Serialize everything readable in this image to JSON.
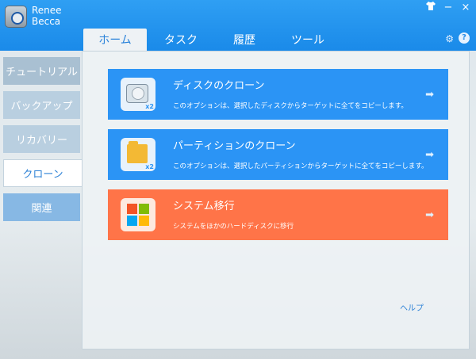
{
  "app": {
    "name_line1": "Renee",
    "name_line2": "Becca"
  },
  "window": {
    "shirt_icon": "shirt-icon",
    "minimize": "−",
    "close": "×"
  },
  "tabs": [
    {
      "label": "ホーム"
    },
    {
      "label": "タスク"
    },
    {
      "label": "履歴"
    },
    {
      "label": "ツール"
    }
  ],
  "sidebar": {
    "items": [
      {
        "label": "チュートリアル"
      },
      {
        "label": "バックアップ"
      },
      {
        "label": "リカバリー"
      },
      {
        "label": "クローン"
      },
      {
        "label": "関連"
      }
    ]
  },
  "cards": [
    {
      "title": "ディスクのクローン",
      "desc": "このオプションは、選択したディスクからターゲットに全てをコピーします。",
      "badge": "x2"
    },
    {
      "title": "パーティションのクローン",
      "desc": "このオプションは、選択したパーティションからターゲットに全てをコピーします。",
      "badge": "x2"
    },
    {
      "title": "システム移行",
      "desc": "システムをほかのハードディスクに移行"
    }
  ],
  "help_link": "ヘルプ",
  "colors": {
    "titlebar": "#1a8ae9",
    "card_blue": "#2b94f5",
    "card_orange": "#ff7448"
  }
}
